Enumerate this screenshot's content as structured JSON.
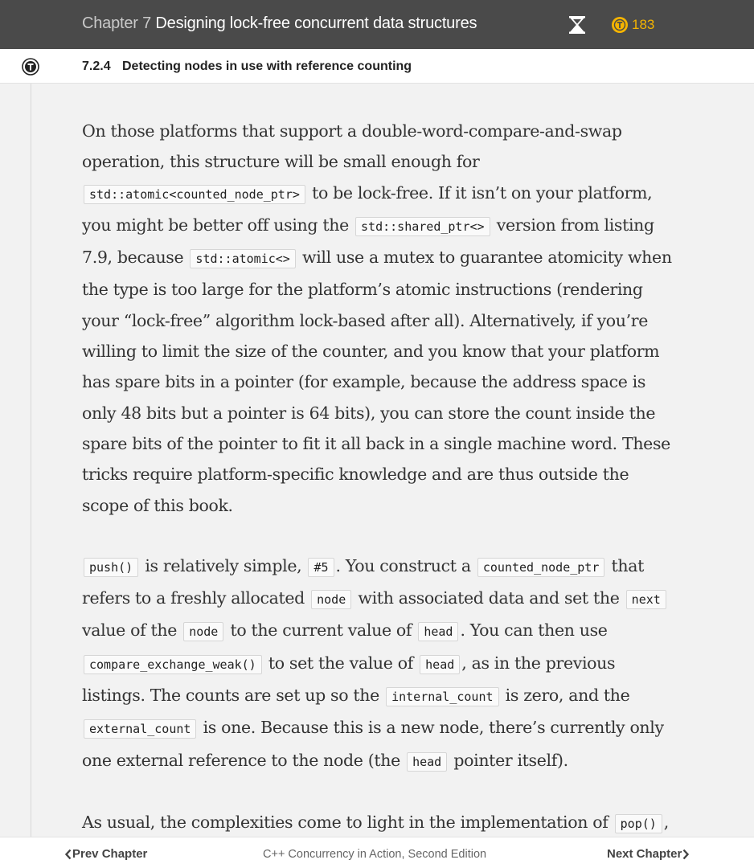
{
  "header": {
    "chapter_label": "Chapter 7",
    "chapter_name": "Designing lock-free concurrent data structures",
    "token_count": "183",
    "accent_color": "#f5b400"
  },
  "section": {
    "number": "7.2.4",
    "title": "Detecting nodes in use with reference counting"
  },
  "body": {
    "p1": {
      "t1": "On those platforms that support a double-word-compare-and-swap operation, this structure will be small enough for ",
      "c1": "std::atomic<counted_node_ptr>",
      "t2": " to be lock-free. If it isn’t on your platform, you might be better off using the ",
      "c2": "std::shared_ptr<>",
      "t3": " version from listing 7.9, because ",
      "c3": "std::atomic<>",
      "t4": " will use a mutex to guarantee atomicity when the type is too large for the platform’s atomic instructions (rendering your “lock-free” algorithm lock-based after all). Alternatively, if you’re willing to limit the size of the counter, and you know that your platform has spare bits in a pointer (for example, because the address space is only 48 bits but a pointer is 64 bits), you can store the count inside the spare bits of the pointer to fit it all back in a single machine word. These tricks require platform-specific knowledge and are thus outside the scope of this book."
    },
    "p2": {
      "c1": "push()",
      "t1": " is relatively simple, ",
      "c2": "#5",
      "t2": ". You construct a ",
      "c3": "counted_node_ptr",
      "t3": " that refers to a freshly allocated ",
      "c4": "node",
      "t4": " with associated data and set the ",
      "c5": "next",
      "t5": " value of the ",
      "c6": "node",
      "t6": " to the current value of ",
      "c7": "head",
      "t7": ". You can then use ",
      "c8": "compare_exchange_weak()",
      "t8": " to set the value of ",
      "c9": "head",
      "t9": ", as in the previous listings. The counts are set up so the ",
      "c10": "internal_count",
      "t10": " is zero, and the ",
      "c11": "external_count",
      "t11": " is one. Because this is a new node, there’s currently only one external reference to the node (the ",
      "c12": "head",
      "t12": " pointer itself)."
    },
    "p3": {
      "t1": "As usual, the complexities come to light in the implementation of ",
      "c1": "pop()",
      "t2": ", which is shown in the following listing."
    }
  },
  "footer": {
    "prev_label": "Prev Chapter",
    "book_title": "C++ Concurrency in Action, Second Edition",
    "next_label": "Next Chapter"
  }
}
